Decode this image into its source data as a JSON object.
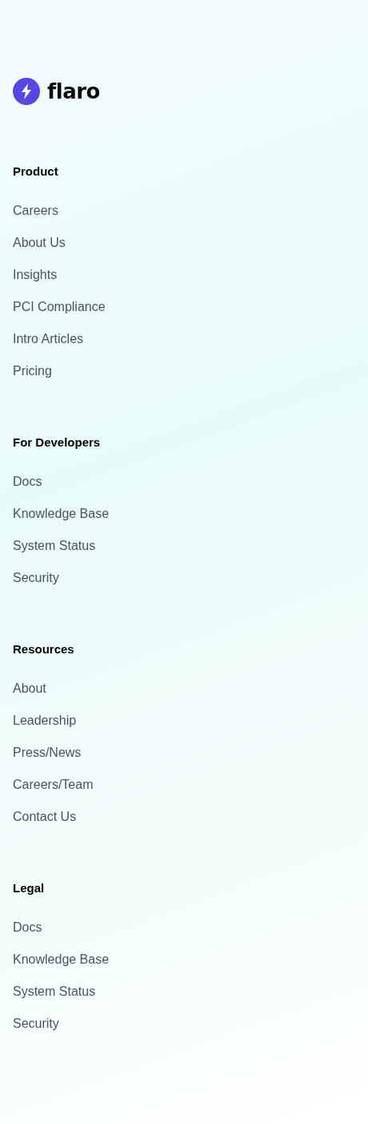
{
  "logo": {
    "name": "flaro"
  },
  "sections": [
    {
      "heading": "Product",
      "links": [
        "Careers",
        "About Us",
        "Insights",
        "PCI Compliance",
        "Intro Articles",
        "Pricing"
      ]
    },
    {
      "heading": "For Developers",
      "links": [
        "Docs",
        "Knowledge Base",
        "System Status",
        "Security"
      ]
    },
    {
      "heading": "Resources",
      "links": [
        "About",
        "Leadership",
        "Press/News",
        "Careers/Team",
        "Contact Us"
      ]
    },
    {
      "heading": "Legal",
      "links": [
        "Docs",
        "Knowledge Base",
        "System Status",
        "Security"
      ]
    }
  ]
}
